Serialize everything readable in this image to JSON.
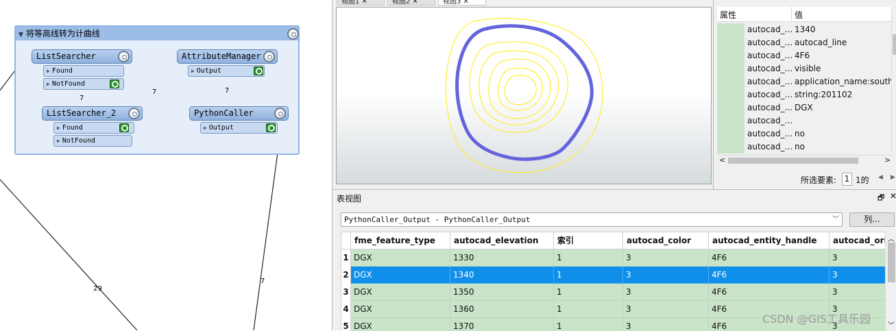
{
  "canvas": {
    "bookmark_title": "将等高线转为计曲线",
    "transformers": {
      "listsearcher": {
        "name": "ListSearcher",
        "ports": [
          "Found",
          "NotFound"
        ]
      },
      "listsearcher2": {
        "name": "ListSearcher_2",
        "ports": [
          "Found",
          "NotFound"
        ]
      },
      "attributemanager": {
        "name": "AttributeManager",
        "ports": [
          "Output"
        ]
      },
      "pythoncaller": {
        "name": "PythonCaller",
        "ports": [
          "Output"
        ]
      }
    },
    "wire_counts": {
      "a": "7",
      "b": "7",
      "c": "7",
      "d": "29",
      "e": "7"
    }
  },
  "view": {
    "tabs": [
      "视图1",
      "视图2",
      "视图3"
    ],
    "contour_color": "#ffee33",
    "highlight_color": "#6464dc"
  },
  "info": {
    "header_attr": "属性",
    "header_value": "值",
    "rows": [
      {
        "attr": "autocad_...",
        "value": "1340"
      },
      {
        "attr": "autocad_...",
        "value": "autocad_line"
      },
      {
        "attr": "autocad_...",
        "value": "4F6"
      },
      {
        "attr": "autocad_...",
        "value": "visible"
      },
      {
        "attr": "autocad_...",
        "value": "application_name:south"
      },
      {
        "attr": "autocad_...",
        "value": "string:201102"
      },
      {
        "attr": "autocad_...",
        "value": "DGX"
      },
      {
        "attr": "autocad_...",
        "value": ""
      },
      {
        "attr": "autocad_...",
        "value": "no"
      },
      {
        "attr": "autocad_...",
        "value": "no"
      }
    ],
    "selected_label": "所选要素:",
    "selected_index": "1",
    "selected_total": "1的"
  },
  "table": {
    "title": "表视图",
    "feature_type": "PythonCaller_Output - PythonCaller_Output",
    "columns_button": "列...",
    "headers": [
      "fme_feature_type",
      "autocad_elevation",
      "索引",
      "autocad_color",
      "autocad_entity_handle",
      "autocad_orig"
    ],
    "rows": [
      {
        "n": "1",
        "cells": [
          "DGX",
          "1330",
          "1",
          "3",
          "4F6",
          "3"
        ]
      },
      {
        "n": "2",
        "cells": [
          "DGX",
          "1340",
          "1",
          "3",
          "4F6",
          "3"
        ]
      },
      {
        "n": "3",
        "cells": [
          "DGX",
          "1350",
          "1",
          "3",
          "4F6",
          "3"
        ]
      },
      {
        "n": "4",
        "cells": [
          "DGX",
          "1360",
          "1",
          "3",
          "4F6",
          "3"
        ]
      },
      {
        "n": "5",
        "cells": [
          "DGX",
          "1370",
          "1",
          "3",
          "4F6",
          "3"
        ]
      }
    ],
    "selected_row": "2"
  },
  "watermark": "CSDN @GIS工具乐园"
}
